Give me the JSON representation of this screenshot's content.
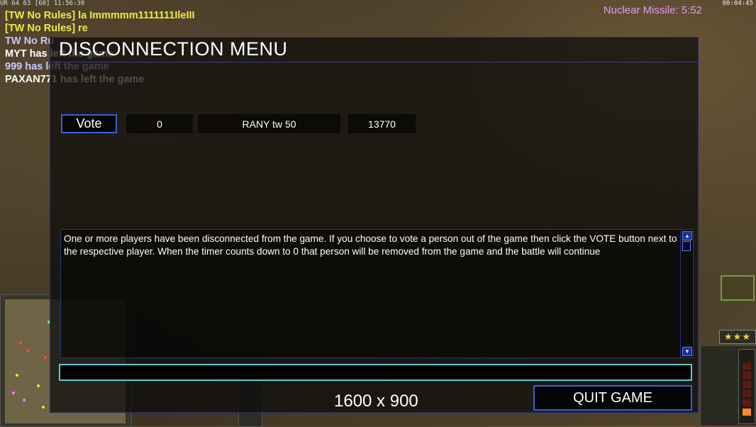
{
  "hud": {
    "stats_line": "UR 64 63 [60] 11:56:30",
    "clock": "00:04:45",
    "superweapon_timer": "Nuclear Missile: 5:52",
    "rank_stars": "★★★"
  },
  "chat": [
    {
      "text": "[TW No Rules] la Immmmm1111111IleIII",
      "color": "#f0e84a"
    },
    {
      "text": "[TW No Rules] re",
      "color": "#f0e84a"
    },
    {
      "text": "TW No Ru",
      "color": "#c9c8ff"
    },
    {
      "text": "MYT has left the game",
      "color": "#ffffff"
    },
    {
      "text": "999 has left the game",
      "color": "#c9c8ff"
    },
    {
      "text": "PAXAN771 has left the game",
      "color": "#ffffff"
    }
  ],
  "dialog": {
    "title": "DISCONNECTION MENU",
    "players": [
      {
        "vote_label": "Vote",
        "votes": "0",
        "name": "RANY tw 50",
        "value": "13770"
      }
    ],
    "message": "One or more players have been disconnected from the game. If you choose to vote a person out of the game then click the VOTE button next to the respective player. When the timer counts down to 0 that person will be removed from the game and the battle will continue",
    "chat_input_value": "",
    "resolution_text": "1600 x 900",
    "quit_label": "QUIT GAME"
  },
  "colors": {
    "accent_border": "#3e5fd6",
    "input_border": "#5ac9d6",
    "chat_yellow": "#f0e84a",
    "superweapon_pink": "#e69be8"
  }
}
